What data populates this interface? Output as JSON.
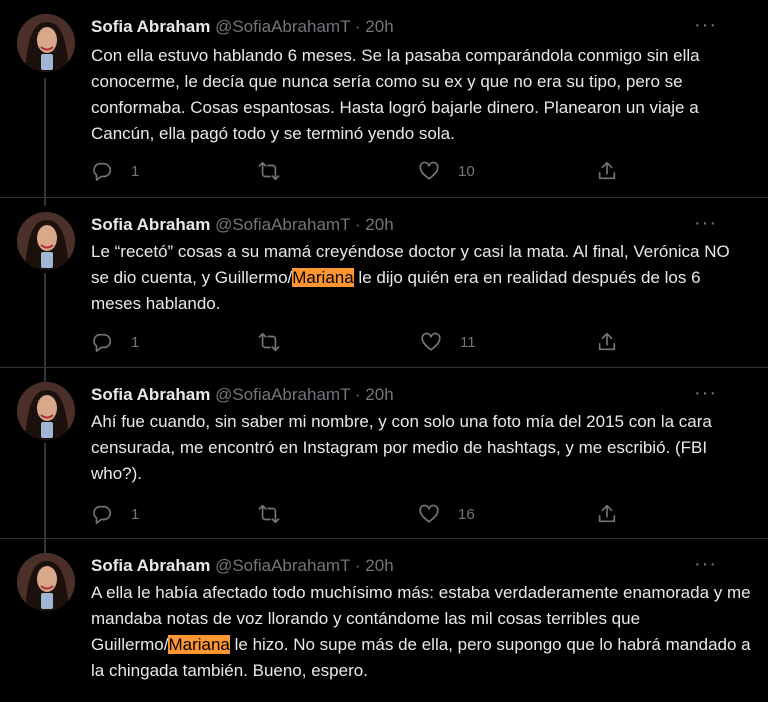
{
  "tweets": [
    {
      "name": "Sofia Abraham",
      "handle": "@SofiaAbrahamT",
      "separator": "·",
      "time": "20h",
      "more": "···",
      "text_parts": [
        "Con ella estuvo hablando 6 meses. Se la pasaba comparándola conmigo sin ella conocerme, le decía que nunca sería como su ex y que no era su tipo, pero se conformaba. Cosas espantosas. Hasta logró bajarle dinero. Planearon un viaje a Cancún, ella pagó todo y se terminó yendo sola."
      ],
      "replies": "1",
      "retweets": "",
      "likes": "10"
    },
    {
      "name": "Sofia Abraham",
      "handle": "@SofiaAbrahamT",
      "separator": "·",
      "time": "20h",
      "more": "···",
      "text_parts": [
        "Le “recetó” cosas a su mamá creyéndose doctor y casi la mata. Al final, Verónica NO se dio cuenta, y Guillermo/",
        "Mariana",
        " le dijo quién era en realidad después de los 6 meses hablando."
      ],
      "replies": "1",
      "retweets": "",
      "likes": "11"
    },
    {
      "name": "Sofia Abraham",
      "handle": "@SofiaAbrahamT",
      "separator": "·",
      "time": "20h",
      "more": "···",
      "text_parts": [
        "Ahí fue cuando, sin saber mi nombre, y con solo una foto mía del 2015 con la cara censurada, me encontró en Instagram por medio de hashtags, y me escribió. (FBI who?)."
      ],
      "replies": "1",
      "retweets": "",
      "likes": "16"
    },
    {
      "name": "Sofia Abraham",
      "handle": "@SofiaAbrahamT",
      "separator": "·",
      "time": "20h",
      "more": "···",
      "text_parts": [
        "A ella le había afectado todo muchísimo más: estaba verdaderamente enamorada y me mandaba notas de voz llorando y contándome las mil cosas terribles que Guillermo/",
        "Mariana",
        " le hizo. No supe más de ella, pero supongo que lo habrá mandado a la chingada también. Bueno, espero."
      ]
    }
  ],
  "icons": [
    "reply-icon",
    "retweet-icon",
    "like-icon",
    "share-icon",
    "more-icon"
  ],
  "colors": {
    "background": "#000000",
    "text": "#e7e9ea",
    "muted": "#71767b",
    "highlight": "#ff9632",
    "divider": "#2f3336"
  }
}
